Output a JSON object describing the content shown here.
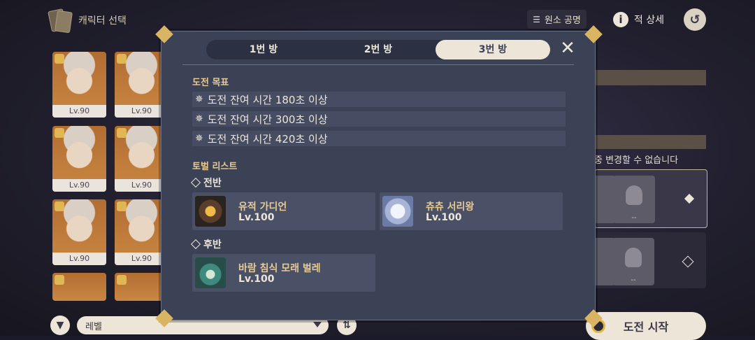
{
  "top": {
    "title": "캐릭터 선택",
    "elements_button": "원소 공명",
    "details_button": "적 상세",
    "info_glyph": "i"
  },
  "characters": [
    {
      "level": "Lv.90"
    },
    {
      "level": "Lv.90"
    },
    {
      "level": "Lv.90"
    },
    {
      "level": "Lv.90"
    },
    {
      "level": "Lv.90"
    },
    {
      "level": "Lv.90"
    },
    {
      "level": ""
    },
    {
      "level": ""
    }
  ],
  "right": {
    "note": "중 변경할 수 없습니다",
    "empty_slot": "--"
  },
  "bottom": {
    "sort_value": "레벨",
    "start_button": "도전 시작"
  },
  "modal": {
    "tabs": [
      "1번 방",
      "2번 방",
      "3번 방"
    ],
    "active_tab": 2,
    "goals_title": "도전 목표",
    "goals": [
      "도전 잔여 시간 180초 이상",
      "도전 잔여 시간 300초 이상",
      "도전 잔여 시간 420초 이상"
    ],
    "boss_list_title": "토벌 리스트",
    "first_half": {
      "label": "전반",
      "bosses": [
        {
          "name": "유적 가디언",
          "level": "Lv.100"
        },
        {
          "name": "츄츄 서리왕",
          "level": "Lv.100"
        }
      ]
    },
    "second_half": {
      "label": "후반",
      "bosses": [
        {
          "name": "바람 침식 모래 벌레",
          "level": "Lv.100"
        }
      ]
    }
  },
  "colors": {
    "accent_gold": "#d9b563",
    "modal_bg": "#3b4256",
    "boss_name": "#e7c994"
  }
}
